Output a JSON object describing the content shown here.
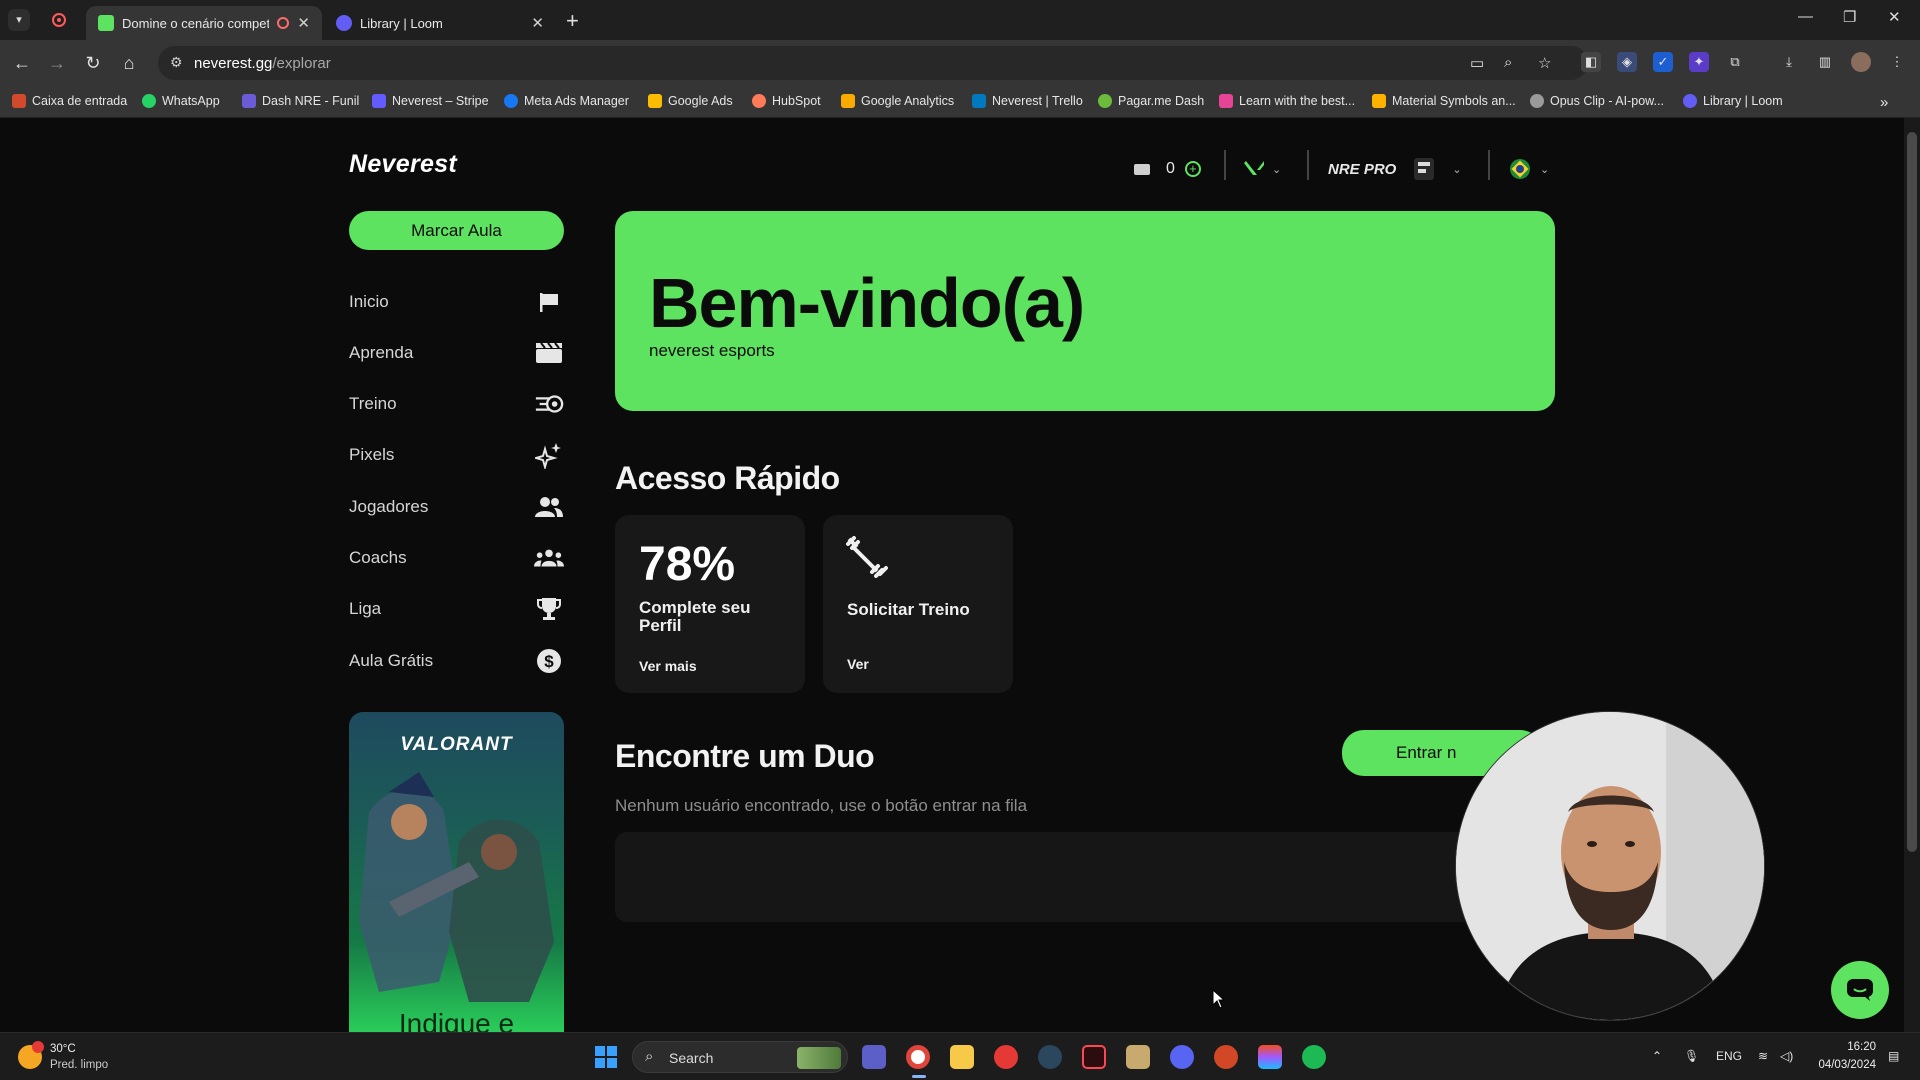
{
  "browser": {
    "tabs": [
      {
        "title": "Domine o cenário competitivo",
        "active": true
      },
      {
        "title": "Library | Loom",
        "active": false
      }
    ],
    "url_host": "neverest.gg",
    "url_path": "/explorar",
    "bookmarks": [
      "Caixa de entrada",
      "WhatsApp",
      "Dash NRE - Funil",
      "Neverest – Stripe",
      "Meta Ads Manager",
      "Google Ads",
      "HubSpot",
      "Google Analytics",
      "Neverest | Trello",
      "Pagar.me Dash",
      "Learn with the best...",
      "Material Symbols an...",
      "Opus Clip - AI-pow...",
      "Library | Loom"
    ],
    "bookmark_colors": [
      "#d04a2b",
      "#25d366",
      "#6b5bd6",
      "#635bff",
      "#1877f2",
      "#fbbc04",
      "#ff7a59",
      "#f9ab00",
      "#0079bf",
      "#6dbb3c",
      "#e64494",
      "#ffb300",
      "#9a9a9a",
      "#625df5"
    ]
  },
  "site": {
    "logo": "Neverest",
    "header": {
      "coins": "0",
      "plan": "NRE PRO"
    },
    "cta_button": "Marcar Aula",
    "nav": [
      {
        "label": "Inicio",
        "icon": "flag-icon"
      },
      {
        "label": "Aprenda",
        "icon": "clapperboard-icon"
      },
      {
        "label": "Treino",
        "icon": "speed-target-icon"
      },
      {
        "label": "Pixels",
        "icon": "sparkles-icon"
      },
      {
        "label": "Jogadores",
        "icon": "users-icon"
      },
      {
        "label": "Coachs",
        "icon": "group-icon"
      },
      {
        "label": "Liga",
        "icon": "trophy-icon"
      },
      {
        "label": "Aula Grátis",
        "icon": "dollar-icon"
      }
    ],
    "promo": {
      "game_logo": "VALORANT",
      "text": "Indique e"
    },
    "hero": {
      "title": "Bem-vindo(a)",
      "subtitle": "neverest esports"
    },
    "quick_access": {
      "title": "Acesso Rápido",
      "cards": [
        {
          "big": "78%",
          "label": "Complete seu Perfil",
          "link": "Ver mais"
        },
        {
          "big": "",
          "label": "Solicitar Treino",
          "link": "Ver"
        }
      ]
    },
    "duo": {
      "title": "Encontre um Duo",
      "button": "Entrar n",
      "empty_message": "Nenhum usuário encontrado, use o botão entrar na fila"
    },
    "accent_color": "#5de35f"
  },
  "taskbar": {
    "weather_temp": "30°C",
    "weather_desc": "Pred. limpo",
    "search_placeholder": "Search",
    "lang": "ENG",
    "time": "16:20",
    "date": "04/03/2024"
  }
}
